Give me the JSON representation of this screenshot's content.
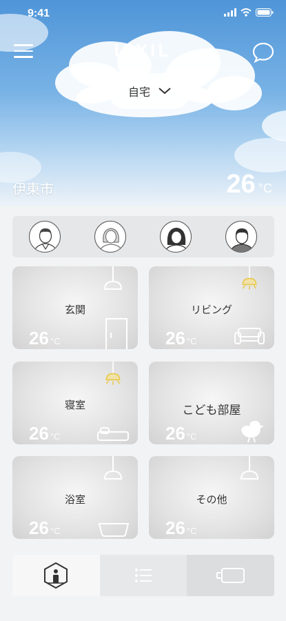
{
  "status_bar": {
    "time": "9:41"
  },
  "header": {
    "logo": "LIXIL"
  },
  "home_selector": {
    "value": "自宅"
  },
  "weather": {
    "city": "伊東市",
    "temperature": "26",
    "unit": "°C"
  },
  "members": [
    "member-1",
    "member-2",
    "member-3",
    "member-4"
  ],
  "rooms": [
    {
      "name": "玄関",
      "temperature": "26",
      "unit": "°C",
      "light_on": false,
      "icon": "door-icon"
    },
    {
      "name": "リビング",
      "temperature": "26",
      "unit": "°C",
      "light_on": true,
      "icon": "sofa-icon"
    },
    {
      "name": "寝室",
      "temperature": "26",
      "unit": "°C",
      "light_on": true,
      "icon": "bed-icon"
    },
    {
      "name": "こども部屋",
      "temperature": "26",
      "unit": "°C",
      "light_on": false,
      "icon": "bird-icon"
    },
    {
      "name": "浴室",
      "temperature": "26",
      "unit": "°C",
      "light_on": false,
      "icon": "bathtub-icon"
    },
    {
      "name": "その他",
      "temperature": "26",
      "unit": "°C",
      "light_on": false,
      "icon": "none"
    }
  ],
  "tabs": [
    "home-info-icon",
    "list-icon",
    "camera-icon"
  ],
  "colors": {
    "lamp_on": "#e8c84a",
    "lamp_off": "#ffffff",
    "sky_top": "#4f95d8"
  }
}
